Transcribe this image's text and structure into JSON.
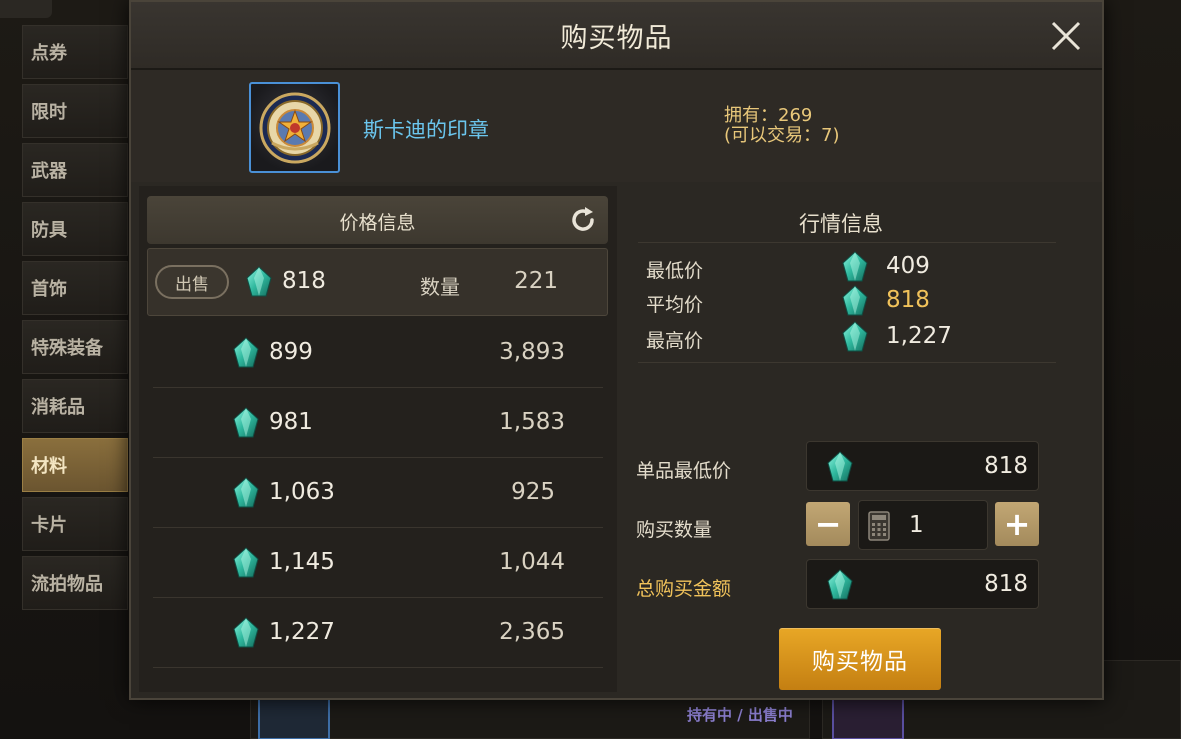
{
  "sidebar": {
    "items": [
      {
        "label": "点券"
      },
      {
        "label": "限时"
      },
      {
        "label": "武器"
      },
      {
        "label": "防具"
      },
      {
        "label": "首饰"
      },
      {
        "label": "特殊装备"
      },
      {
        "label": "消耗品"
      },
      {
        "label": "材料",
        "active": true
      },
      {
        "label": "卡片"
      },
      {
        "label": "流拍物品"
      }
    ]
  },
  "background": {
    "status_left": "持有中 / 出售中"
  },
  "modal": {
    "title": "购买物品",
    "item": {
      "name": "斯卡迪的印章",
      "owned_line": "拥有：269",
      "tradable_line": "(可以交易：7)",
      "icon": "seal-icon"
    },
    "price_info": {
      "title": "价格信息",
      "first_row": {
        "sell_label": "出售",
        "price": "818",
        "qty_label": "数量",
        "qty": "221"
      },
      "rows": [
        {
          "price": "899",
          "qty": "3,893"
        },
        {
          "price": "981",
          "qty": "1,583"
        },
        {
          "price": "1,063",
          "qty": "925"
        },
        {
          "price": "1,145",
          "qty": "1,044"
        },
        {
          "price": "1,227",
          "qty": "2,365"
        }
      ]
    },
    "market_info": {
      "title": "行情信息",
      "lowest_label": "最低价",
      "lowest_value": "409",
      "average_label": "平均价",
      "average_value": "818",
      "highest_label": "最高价",
      "highest_value": "1,227"
    },
    "purchase": {
      "unit_min_label": "单品最低价",
      "unit_min_value": "818",
      "qty_label": "购买数量",
      "qty_value": "1",
      "minus": "−",
      "plus": "+",
      "total_label": "总购买金额",
      "total_value": "818",
      "buy_button": "购买物品"
    }
  },
  "colors": {
    "accent_gold": "#f0c25a",
    "buy_button": "#e0a020",
    "item_name": "#6bc6ee",
    "gem": "#3fc9b0"
  }
}
